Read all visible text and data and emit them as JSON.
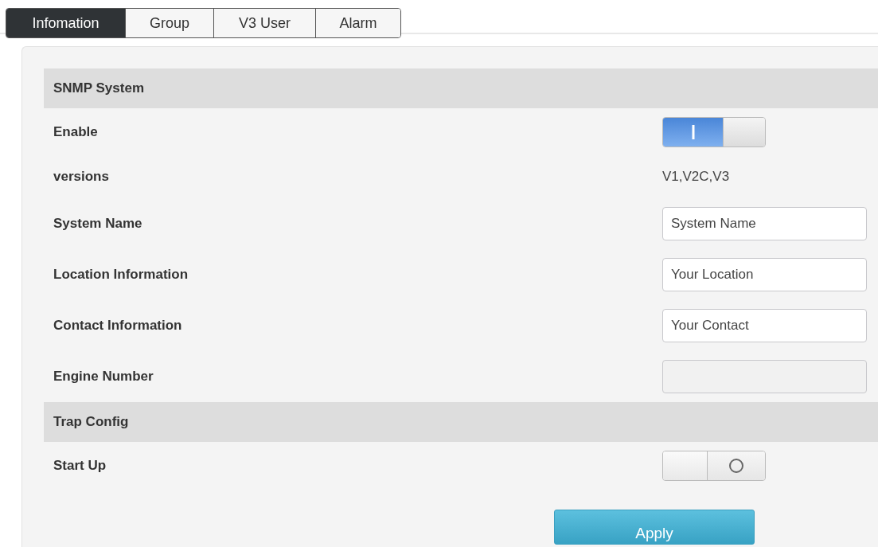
{
  "tabs": [
    {
      "label": "Infomation",
      "selected": true
    },
    {
      "label": "Group",
      "selected": false
    },
    {
      "label": "V3 User",
      "selected": false
    },
    {
      "label": "Alarm",
      "selected": false
    }
  ],
  "sections": [
    {
      "title": "SNMP System",
      "rows": [
        {
          "kind": "toggle",
          "label": "Enable",
          "on": true
        },
        {
          "kind": "text",
          "label": "versions",
          "value": "V1,V2C,V3"
        },
        {
          "kind": "input",
          "label": "System Name",
          "value": "System Name",
          "disabled": false
        },
        {
          "kind": "input",
          "label": "Location Information",
          "value": "Your Location",
          "disabled": false
        },
        {
          "kind": "input",
          "label": "Contact Information",
          "value": "Your Contact",
          "disabled": false
        },
        {
          "kind": "input",
          "label": "Engine Number",
          "disabled": true
        }
      ]
    },
    {
      "title": "Trap Config",
      "rows": [
        {
          "kind": "toggle",
          "label": "Start Up",
          "on": false
        }
      ]
    }
  ],
  "apply_button": "Apply"
}
